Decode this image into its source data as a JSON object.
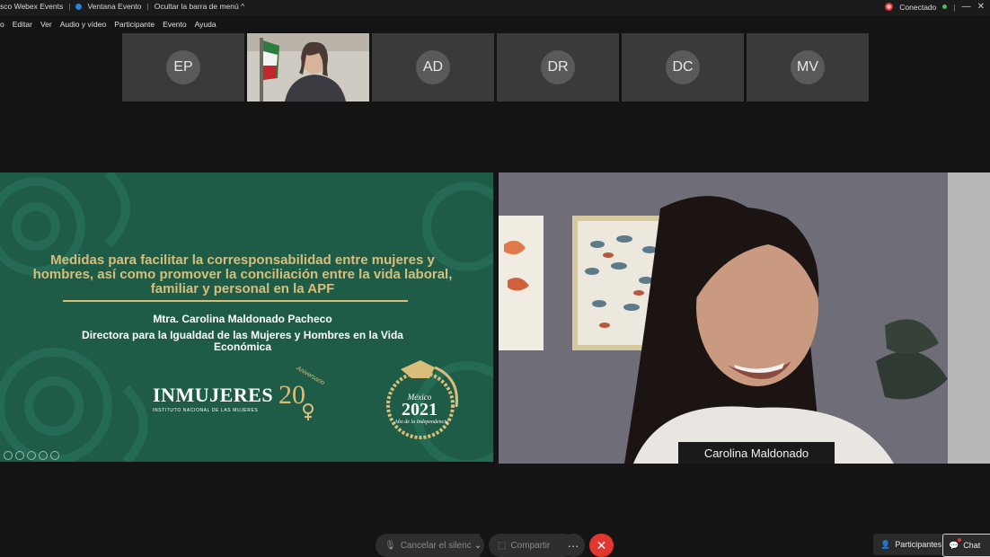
{
  "titlebar": {
    "app_name": "sco Webex Events",
    "window_label": "Ventana Evento",
    "hide_menu": "Ocultar la barra de menú ^",
    "status": "Conectado"
  },
  "menu": {
    "items": [
      "o",
      "Editar",
      "Ver",
      "Audio y vídeo",
      "Participante",
      "Evento",
      "Ayuda"
    ]
  },
  "thumbnails": [
    {
      "initials": "EP"
    },
    {
      "initials": ""
    },
    {
      "initials": "AD"
    },
    {
      "initials": "DR"
    },
    {
      "initials": "DC"
    },
    {
      "initials": "MV"
    }
  ],
  "slide": {
    "title": "Medidas para facilitar la corresponsabilidad entre mujeres y hombres, así como promover la conciliación entre la vida laboral, familiar y personal en la APF",
    "presenter": "Mtra. Carolina Maldonado Pacheco",
    "role": "Directora para la Igualdad de las Mujeres y Hombres en la Vida Económica",
    "inm_logo": {
      "word": "INMUJERES",
      "sub": "INSTITUTO NACIONAL DE LAS MUJERES",
      "number": "20",
      "badge": "Aniversario"
    },
    "mx_logo": {
      "country": "México",
      "year": "2021",
      "caption": "Año de la Independencia"
    },
    "colors": {
      "background": "#1e5c48",
      "accent": "#d9be7a"
    }
  },
  "speaker": {
    "name": "Carolina Maldonado"
  },
  "controls": {
    "mute": "Cancelar el silencio",
    "share": "Compartir",
    "more": "···",
    "leave": "✕",
    "participants": "Participantes",
    "chat": "Chat"
  }
}
